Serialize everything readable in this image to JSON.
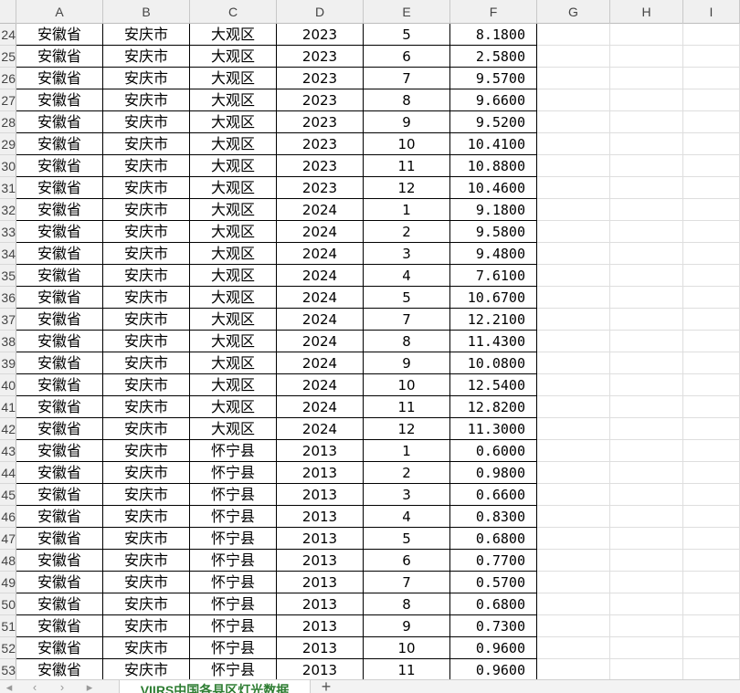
{
  "columns": [
    "A",
    "B",
    "C",
    "D",
    "E",
    "F",
    "G",
    "H",
    "I"
  ],
  "rows": [
    {
      "n": "24",
      "a": "安徽省",
      "b": "安庆市",
      "c": "大观区",
      "d": "2023",
      "e": "5",
      "f": "8.1800"
    },
    {
      "n": "25",
      "a": "安徽省",
      "b": "安庆市",
      "c": "大观区",
      "d": "2023",
      "e": "6",
      "f": "2.5800"
    },
    {
      "n": "26",
      "a": "安徽省",
      "b": "安庆市",
      "c": "大观区",
      "d": "2023",
      "e": "7",
      "f": "9.5700"
    },
    {
      "n": "27",
      "a": "安徽省",
      "b": "安庆市",
      "c": "大观区",
      "d": "2023",
      "e": "8",
      "f": "9.6600"
    },
    {
      "n": "28",
      "a": "安徽省",
      "b": "安庆市",
      "c": "大观区",
      "d": "2023",
      "e": "9",
      "f": "9.5200"
    },
    {
      "n": "29",
      "a": "安徽省",
      "b": "安庆市",
      "c": "大观区",
      "d": "2023",
      "e": "10",
      "f": "10.4100"
    },
    {
      "n": "30",
      "a": "安徽省",
      "b": "安庆市",
      "c": "大观区",
      "d": "2023",
      "e": "11",
      "f": "10.8800"
    },
    {
      "n": "31",
      "a": "安徽省",
      "b": "安庆市",
      "c": "大观区",
      "d": "2023",
      "e": "12",
      "f": "10.4600"
    },
    {
      "n": "32",
      "a": "安徽省",
      "b": "安庆市",
      "c": "大观区",
      "d": "2024",
      "e": "1",
      "f": "9.1800"
    },
    {
      "n": "33",
      "a": "安徽省",
      "b": "安庆市",
      "c": "大观区",
      "d": "2024",
      "e": "2",
      "f": "9.5800"
    },
    {
      "n": "34",
      "a": "安徽省",
      "b": "安庆市",
      "c": "大观区",
      "d": "2024",
      "e": "3",
      "f": "9.4800"
    },
    {
      "n": "35",
      "a": "安徽省",
      "b": "安庆市",
      "c": "大观区",
      "d": "2024",
      "e": "4",
      "f": "7.6100"
    },
    {
      "n": "36",
      "a": "安徽省",
      "b": "安庆市",
      "c": "大观区",
      "d": "2024",
      "e": "5",
      "f": "10.6700"
    },
    {
      "n": "37",
      "a": "安徽省",
      "b": "安庆市",
      "c": "大观区",
      "d": "2024",
      "e": "7",
      "f": "12.2100"
    },
    {
      "n": "38",
      "a": "安徽省",
      "b": "安庆市",
      "c": "大观区",
      "d": "2024",
      "e": "8",
      "f": "11.4300"
    },
    {
      "n": "39",
      "a": "安徽省",
      "b": "安庆市",
      "c": "大观区",
      "d": "2024",
      "e": "9",
      "f": "10.0800"
    },
    {
      "n": "40",
      "a": "安徽省",
      "b": "安庆市",
      "c": "大观区",
      "d": "2024",
      "e": "10",
      "f": "12.5400"
    },
    {
      "n": "41",
      "a": "安徽省",
      "b": "安庆市",
      "c": "大观区",
      "d": "2024",
      "e": "11",
      "f": "12.8200"
    },
    {
      "n": "42",
      "a": "安徽省",
      "b": "安庆市",
      "c": "大观区",
      "d": "2024",
      "e": "12",
      "f": "11.3000"
    },
    {
      "n": "43",
      "a": "安徽省",
      "b": "安庆市",
      "c": "怀宁县",
      "d": "2013",
      "e": "1",
      "f": "0.6000"
    },
    {
      "n": "44",
      "a": "安徽省",
      "b": "安庆市",
      "c": "怀宁县",
      "d": "2013",
      "e": "2",
      "f": "0.9800"
    },
    {
      "n": "45",
      "a": "安徽省",
      "b": "安庆市",
      "c": "怀宁县",
      "d": "2013",
      "e": "3",
      "f": "0.6600"
    },
    {
      "n": "46",
      "a": "安徽省",
      "b": "安庆市",
      "c": "怀宁县",
      "d": "2013",
      "e": "4",
      "f": "0.8300"
    },
    {
      "n": "47",
      "a": "安徽省",
      "b": "安庆市",
      "c": "怀宁县",
      "d": "2013",
      "e": "5",
      "f": "0.6800"
    },
    {
      "n": "48",
      "a": "安徽省",
      "b": "安庆市",
      "c": "怀宁县",
      "d": "2013",
      "e": "6",
      "f": "0.7700"
    },
    {
      "n": "49",
      "a": "安徽省",
      "b": "安庆市",
      "c": "怀宁县",
      "d": "2013",
      "e": "7",
      "f": "0.5700"
    },
    {
      "n": "50",
      "a": "安徽省",
      "b": "安庆市",
      "c": "怀宁县",
      "d": "2013",
      "e": "8",
      "f": "0.6800"
    },
    {
      "n": "51",
      "a": "安徽省",
      "b": "安庆市",
      "c": "怀宁县",
      "d": "2013",
      "e": "9",
      "f": "0.7300"
    },
    {
      "n": "52",
      "a": "安徽省",
      "b": "安庆市",
      "c": "怀宁县",
      "d": "2013",
      "e": "10",
      "f": "0.9600"
    },
    {
      "n": "53",
      "a": "安徽省",
      "b": "安庆市",
      "c": "怀宁县",
      "d": "2013",
      "e": "11",
      "f": "0.9600"
    }
  ],
  "tabbar": {
    "nav_icons": [
      "first-sheet-icon",
      "prev-sheet-icon",
      "next-sheet-icon",
      "last-sheet-icon"
    ],
    "sheet_tab_label": "VIIRS中国各县区灯光数据",
    "add_sheet_icon": "plus-icon"
  },
  "colors": {
    "sheet_tab_text": "#2e7d32",
    "grid_line": "#dedede",
    "header_bg": "#f0f0f0"
  }
}
